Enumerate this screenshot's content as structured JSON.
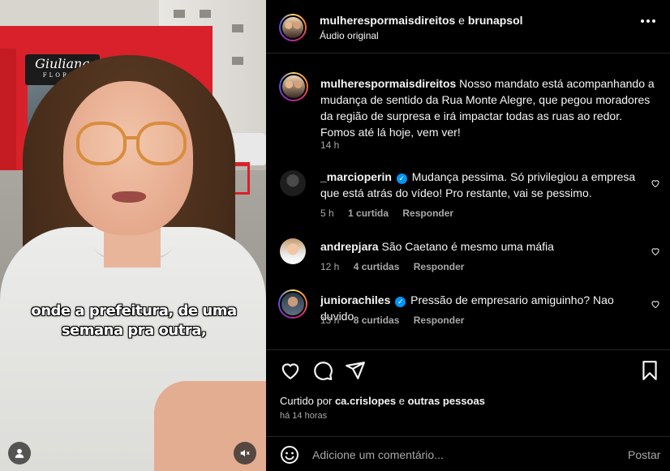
{
  "video": {
    "store_sign": "Giuliana",
    "store_sign_sub": "FLORES",
    "caption_lines": [
      "onde a prefeitura, de uma",
      "semana pra outra,"
    ]
  },
  "header": {
    "user1": "mulherespormaisdireitos",
    "joiner": "e",
    "user2": "brunapsol",
    "audio": "Áudio original"
  },
  "post": {
    "username": "mulherespormaisdireitos",
    "text": "Nosso mandato está acompanhando a mudança de sentido da Rua Monte Alegre, que pegou moradores da região de surpresa e irá impactar todas as ruas ao redor. Fomos até lá hoje, vem ver!",
    "time": "14 h"
  },
  "comments": [
    {
      "username": "_marcioperin",
      "verified": true,
      "text": "Mudança pessima. Só privilegiou a empresa que está atrás do vídeo! Pro restante, vai se pessimo.",
      "time": "5 h",
      "likes": "1 curtida",
      "reply": "Responder"
    },
    {
      "username": "andrepjara",
      "verified": false,
      "text": "São Caetano é mesmo uma máfia",
      "time": "12 h",
      "likes": "4 curtidas",
      "reply": "Responder"
    },
    {
      "username": "juniorachiles",
      "verified": true,
      "text": "Pressão de empresario amiguinho? Nao duvido",
      "time": "13 h",
      "likes": "8 curtidas",
      "reply": "Responder"
    }
  ],
  "actions": {
    "liked_prefix": "Curtido por",
    "liked_user": "ca.crislopes",
    "liked_joiner": "e",
    "liked_others": "outras pessoas",
    "ago": "há 14 horas"
  },
  "composer": {
    "placeholder": "Adicione um comentário...",
    "post_label": "Postar"
  },
  "colors": {
    "background": "#000000",
    "text": "#f5f5f5",
    "muted": "#a8a8a8",
    "verified": "#0095f6"
  }
}
